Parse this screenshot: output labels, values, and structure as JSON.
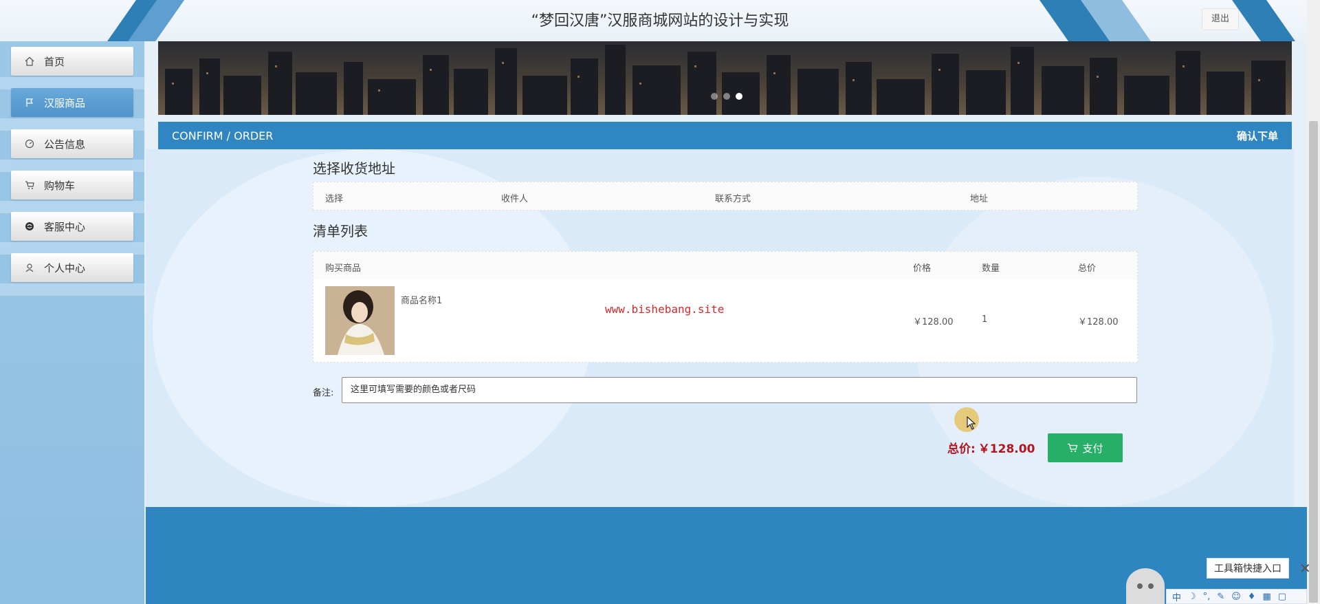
{
  "header": {
    "title": "“梦回汉唐”汉服商城网站的设计与实现",
    "logout_label": "退出"
  },
  "sidebar": {
    "items": [
      {
        "label": "首页",
        "icon": "home-icon",
        "active": false
      },
      {
        "label": "汉服商品",
        "icon": "flag-icon",
        "active": true
      },
      {
        "label": "公告信息",
        "icon": "gauge-icon",
        "active": false
      },
      {
        "label": "购物车",
        "icon": "cart-icon",
        "active": false
      },
      {
        "label": "客服中心",
        "icon": "support-icon",
        "active": false
      },
      {
        "label": "个人中心",
        "icon": "user-icon",
        "active": false
      }
    ]
  },
  "banner": {
    "slides": 3,
    "active_slide": 3
  },
  "section": {
    "left_label": "CONFIRM / ORDER",
    "right_label": "确认下单"
  },
  "address": {
    "title": "选择收货地址",
    "columns": [
      "选择",
      "收件人",
      "联系方式",
      "地址"
    ]
  },
  "order_list": {
    "title": "清单列表",
    "columns": [
      "购买商品",
      "价格",
      "数量",
      "总价"
    ],
    "rows": [
      {
        "name": "商品名称1",
        "price": "￥128.00",
        "quantity": "1",
        "subtotal": "￥128.00"
      }
    ]
  },
  "watermark": "www.bishebang.site",
  "remark": {
    "label": "备注:",
    "value": "这里可填写需要的颜色或者尺码"
  },
  "summary": {
    "total_label": "总价:",
    "total_value": "￥128.00",
    "pay_label": "支付"
  },
  "toolbox": {
    "label": "工具箱快捷入口",
    "ime_mode": "中"
  },
  "colors": {
    "primary": "#2f86c2",
    "pay_button": "#27ae67",
    "total_text": "#b3151f",
    "sidebar_active": "#4e93c9"
  }
}
